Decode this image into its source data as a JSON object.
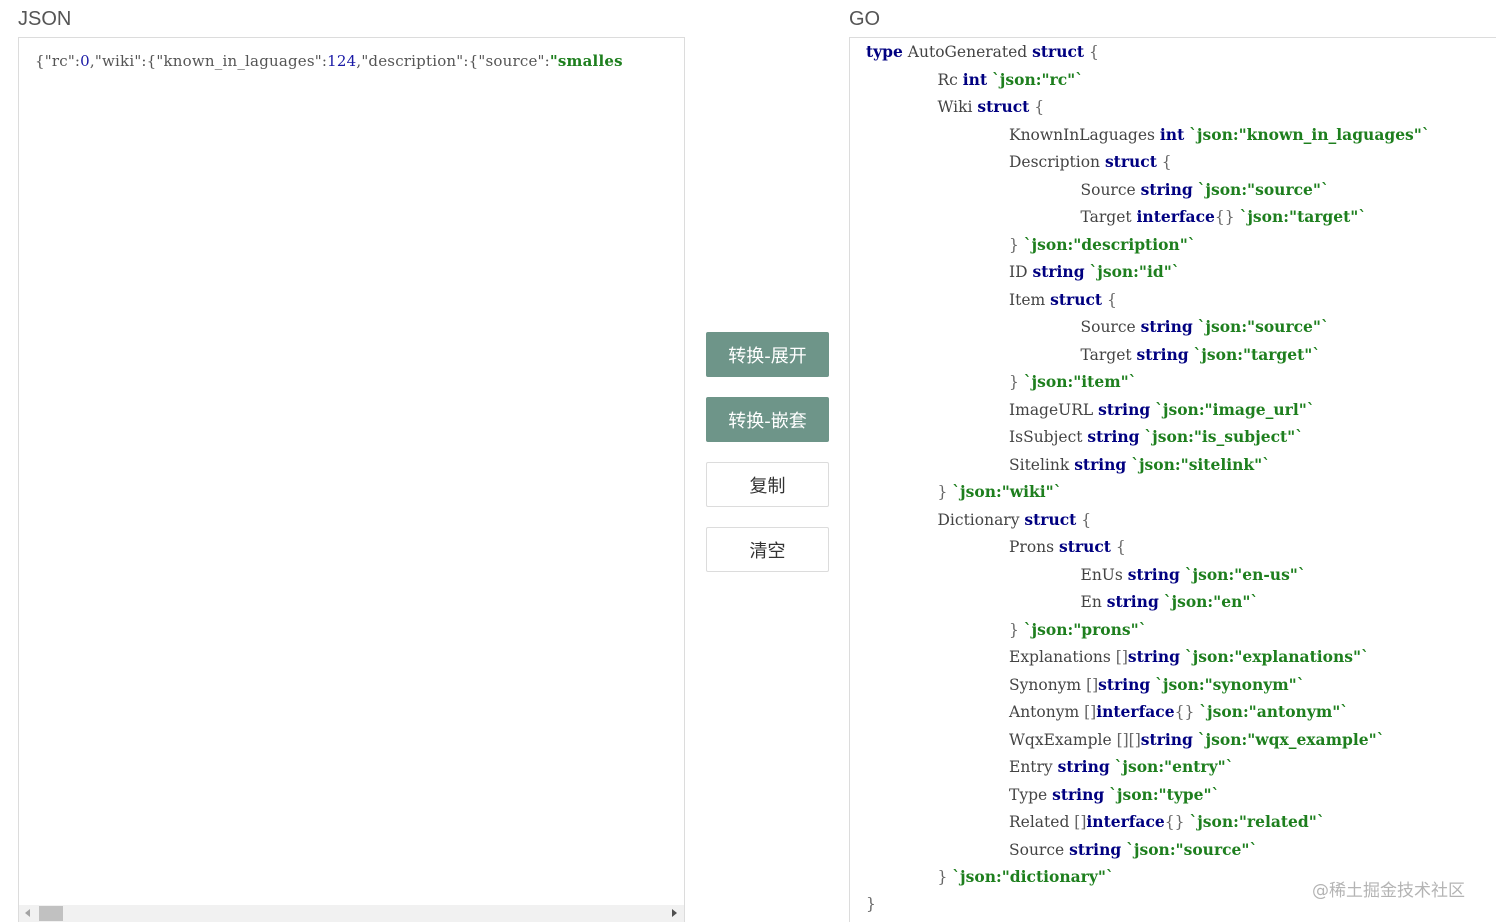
{
  "panels": {
    "json_title": "JSON",
    "go_title": "GO"
  },
  "json_input": {
    "segments": [
      {
        "t": "{\"rc\":",
        "c": "str"
      },
      {
        "t": "0",
        "c": "num"
      },
      {
        "t": ",\"wiki\":{\"known_in_laguages\":",
        "c": "str"
      },
      {
        "t": "124",
        "c": "num"
      },
      {
        "t": ",\"description\":{\"source\":",
        "c": "str"
      },
      {
        "t": "\"smalles",
        "c": "val"
      }
    ]
  },
  "buttons": {
    "expand": "转换-展开",
    "nested": "转换-嵌套",
    "copy": "复制",
    "clear": "清空"
  },
  "go_code": {
    "lines": [
      {
        "indent": 0,
        "seg": [
          [
            "kw",
            "type"
          ],
          [
            "id",
            " AutoGenerated "
          ],
          [
            "kw",
            "struct"
          ],
          [
            "pn",
            " {"
          ]
        ]
      },
      {
        "indent": 1,
        "seg": [
          [
            "id",
            "Rc "
          ],
          [
            "kw",
            "int"
          ],
          [
            "id",
            " "
          ],
          [
            "tag",
            "`json:\"rc\"`"
          ]
        ]
      },
      {
        "indent": 1,
        "seg": [
          [
            "id",
            "Wiki "
          ],
          [
            "kw",
            "struct"
          ],
          [
            "pn",
            " {"
          ]
        ]
      },
      {
        "indent": 2,
        "seg": [
          [
            "id",
            "KnownInLaguages "
          ],
          [
            "kw",
            "int"
          ],
          [
            "id",
            " "
          ],
          [
            "tag",
            "`json:\"known_in_laguages\"`"
          ]
        ]
      },
      {
        "indent": 2,
        "seg": [
          [
            "id",
            "Description "
          ],
          [
            "kw",
            "struct"
          ],
          [
            "pn",
            " {"
          ]
        ]
      },
      {
        "indent": 3,
        "seg": [
          [
            "id",
            "Source "
          ],
          [
            "kw",
            "string"
          ],
          [
            "id",
            " "
          ],
          [
            "tag",
            "`json:\"source\"`"
          ]
        ]
      },
      {
        "indent": 3,
        "seg": [
          [
            "id",
            "Target "
          ],
          [
            "kw",
            "interface"
          ],
          [
            "pn",
            "{}"
          ],
          [
            "id",
            " "
          ],
          [
            "tag",
            "`json:\"target\"`"
          ]
        ]
      },
      {
        "indent": 2,
        "seg": [
          [
            "pn",
            "} "
          ],
          [
            "tag",
            "`json:\"description\"`"
          ]
        ]
      },
      {
        "indent": 2,
        "seg": [
          [
            "id",
            "ID "
          ],
          [
            "kw",
            "string"
          ],
          [
            "id",
            " "
          ],
          [
            "tag",
            "`json:\"id\"`"
          ]
        ]
      },
      {
        "indent": 2,
        "seg": [
          [
            "id",
            "Item "
          ],
          [
            "kw",
            "struct"
          ],
          [
            "pn",
            " {"
          ]
        ]
      },
      {
        "indent": 3,
        "seg": [
          [
            "id",
            "Source "
          ],
          [
            "kw",
            "string"
          ],
          [
            "id",
            " "
          ],
          [
            "tag",
            "`json:\"source\"`"
          ]
        ]
      },
      {
        "indent": 3,
        "seg": [
          [
            "id",
            "Target "
          ],
          [
            "kw",
            "string"
          ],
          [
            "id",
            " "
          ],
          [
            "tag",
            "`json:\"target\"`"
          ]
        ]
      },
      {
        "indent": 2,
        "seg": [
          [
            "pn",
            "} "
          ],
          [
            "tag",
            "`json:\"item\"`"
          ]
        ]
      },
      {
        "indent": 2,
        "seg": [
          [
            "id",
            "ImageURL "
          ],
          [
            "kw",
            "string"
          ],
          [
            "id",
            " "
          ],
          [
            "tag",
            "`json:\"image_url\"`"
          ]
        ]
      },
      {
        "indent": 2,
        "seg": [
          [
            "id",
            "IsSubject "
          ],
          [
            "kw",
            "string"
          ],
          [
            "id",
            " "
          ],
          [
            "tag",
            "`json:\"is_subject\"`"
          ]
        ]
      },
      {
        "indent": 2,
        "seg": [
          [
            "id",
            "Sitelink "
          ],
          [
            "kw",
            "string"
          ],
          [
            "id",
            " "
          ],
          [
            "tag",
            "`json:\"sitelink\"`"
          ]
        ]
      },
      {
        "indent": 1,
        "seg": [
          [
            "pn",
            "} "
          ],
          [
            "tag",
            "`json:\"wiki\"`"
          ]
        ]
      },
      {
        "indent": 1,
        "seg": [
          [
            "id",
            "Dictionary "
          ],
          [
            "kw",
            "struct"
          ],
          [
            "pn",
            " {"
          ]
        ]
      },
      {
        "indent": 2,
        "seg": [
          [
            "id",
            "Prons "
          ],
          [
            "kw",
            "struct"
          ],
          [
            "pn",
            " {"
          ]
        ]
      },
      {
        "indent": 3,
        "seg": [
          [
            "id",
            "EnUs "
          ],
          [
            "kw",
            "string"
          ],
          [
            "id",
            " "
          ],
          [
            "tag",
            "`json:\"en-us\"`"
          ]
        ]
      },
      {
        "indent": 3,
        "seg": [
          [
            "id",
            "En "
          ],
          [
            "kw",
            "string"
          ],
          [
            "id",
            " "
          ],
          [
            "tag",
            "`json:\"en\"`"
          ]
        ]
      },
      {
        "indent": 2,
        "seg": [
          [
            "pn",
            "} "
          ],
          [
            "tag",
            "`json:\"prons\"`"
          ]
        ]
      },
      {
        "indent": 2,
        "seg": [
          [
            "id",
            "Explanations "
          ],
          [
            "pn",
            "[]"
          ],
          [
            "kw",
            "string"
          ],
          [
            "id",
            " "
          ],
          [
            "tag",
            "`json:\"explanations\"`"
          ]
        ]
      },
      {
        "indent": 2,
        "seg": [
          [
            "id",
            "Synonym "
          ],
          [
            "pn",
            "[]"
          ],
          [
            "kw",
            "string"
          ],
          [
            "id",
            " "
          ],
          [
            "tag",
            "`json:\"synonym\"`"
          ]
        ]
      },
      {
        "indent": 2,
        "seg": [
          [
            "id",
            "Antonym "
          ],
          [
            "pn",
            "[]"
          ],
          [
            "kw",
            "interface"
          ],
          [
            "pn",
            "{}"
          ],
          [
            "id",
            " "
          ],
          [
            "tag",
            "`json:\"antonym\"`"
          ]
        ]
      },
      {
        "indent": 2,
        "seg": [
          [
            "id",
            "WqxExample "
          ],
          [
            "pn",
            "[][]"
          ],
          [
            "kw",
            "string"
          ],
          [
            "id",
            " "
          ],
          [
            "tag",
            "`json:\"wqx_example\"`"
          ]
        ]
      },
      {
        "indent": 2,
        "seg": [
          [
            "id",
            "Entry "
          ],
          [
            "kw",
            "string"
          ],
          [
            "id",
            " "
          ],
          [
            "tag",
            "`json:\"entry\"`"
          ]
        ]
      },
      {
        "indent": 2,
        "seg": [
          [
            "id",
            "Type "
          ],
          [
            "kw",
            "string"
          ],
          [
            "id",
            " "
          ],
          [
            "tag",
            "`json:\"type\"`"
          ]
        ]
      },
      {
        "indent": 2,
        "seg": [
          [
            "id",
            "Related "
          ],
          [
            "pn",
            "[]"
          ],
          [
            "kw",
            "interface"
          ],
          [
            "pn",
            "{}"
          ],
          [
            "id",
            " "
          ],
          [
            "tag",
            "`json:\"related\"`"
          ]
        ]
      },
      {
        "indent": 2,
        "seg": [
          [
            "id",
            "Source "
          ],
          [
            "kw",
            "string"
          ],
          [
            "id",
            " "
          ],
          [
            "tag",
            "`json:\"source\"`"
          ]
        ]
      },
      {
        "indent": 1,
        "seg": [
          [
            "pn",
            "} "
          ],
          [
            "tag",
            "`json:\"dictionary\"`"
          ]
        ]
      },
      {
        "indent": 0,
        "seg": [
          [
            "pn",
            "}"
          ]
        ]
      }
    ]
  },
  "watermark": "@稀土掘金技术社区",
  "colors": {
    "primary_button": "#6e9589",
    "keyword": "#000080",
    "tag": "#1e7f1e",
    "number": "#1a1aa6"
  }
}
